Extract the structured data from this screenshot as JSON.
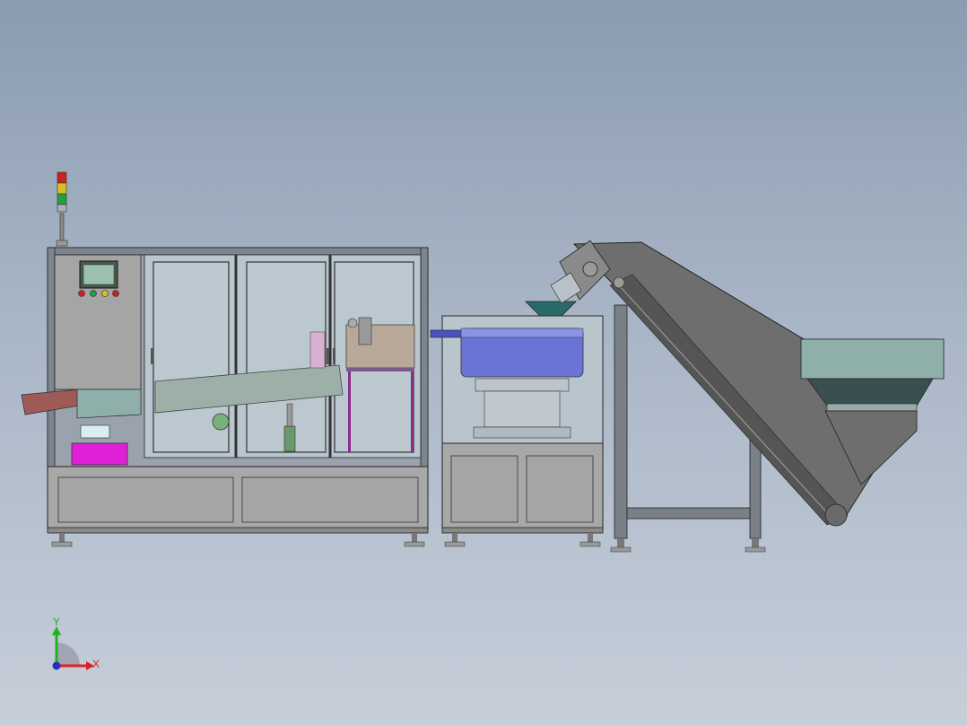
{
  "model_view": {
    "triad": {
      "y_label": "Y",
      "x_label": "X",
      "y_color": "#22b022",
      "x_color": "#e02020",
      "z_color": "#2030c0"
    },
    "colors": {
      "background_top": "#8b9cb0",
      "background_bottom": "#c6ced9",
      "frame": "#7d8590",
      "panel_gray": "#a5a5a5",
      "glass": "#b8c6cf",
      "bowl_blue": "#6a74d4",
      "hopper_teal": "#8fb0aa",
      "conveyor_dark": "#6e6e6e",
      "magenta_bin": "#e020d8",
      "signal_red": "#d02020",
      "signal_yellow": "#d8c020",
      "signal_green": "#20a040"
    }
  }
}
